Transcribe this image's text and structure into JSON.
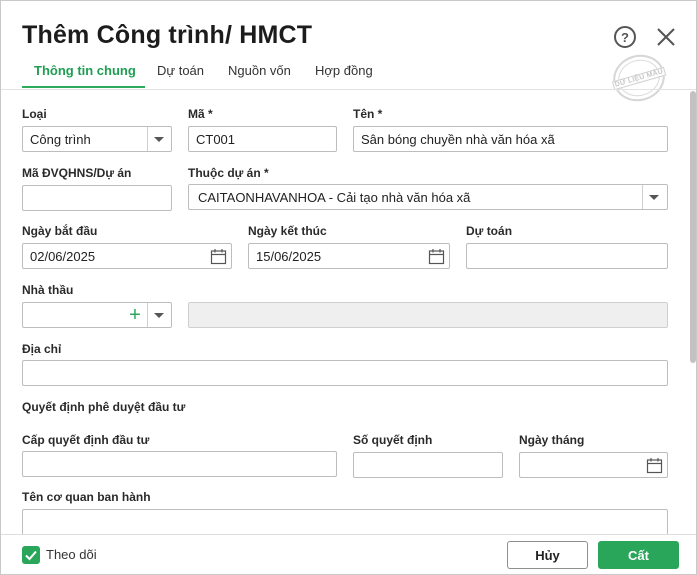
{
  "dialog": {
    "title": "Thêm Công trình/ HMCT",
    "help_icon": "?",
    "close_icon": "close-icon",
    "stamp_text": "DỮ LIỆU MẪU"
  },
  "tabs": [
    {
      "label": "Thông tin chung",
      "active": true
    },
    {
      "label": "Dự toán",
      "active": false
    },
    {
      "label": "Nguồn vốn",
      "active": false
    },
    {
      "label": "Hợp đồng",
      "active": false
    }
  ],
  "form": {
    "loai": {
      "label": "Loại",
      "value": "Công trình"
    },
    "ma": {
      "label": "Mã *",
      "value": "CT001"
    },
    "ten": {
      "label": "Tên *",
      "value": "Sân bóng chuyền nhà văn hóa xã"
    },
    "ma_dvqhns": {
      "label": "Mã ĐVQHNS/Dự án",
      "value": ""
    },
    "thuoc_du_an": {
      "label": "Thuộc dự án *",
      "value": "CAITAONHAVANHOA - Cải tạo nhà văn hóa xã"
    },
    "ngay_bat_dau": {
      "label": "Ngày bắt đầu",
      "value": "02/06/2025"
    },
    "ngay_ket_thuc": {
      "label": "Ngày kết thúc",
      "value": "15/06/2025"
    },
    "du_toan": {
      "label": "Dự toán",
      "value": ""
    },
    "nha_thau": {
      "label": "Nhà thầu",
      "value": "",
      "name_value": ""
    },
    "dia_chi": {
      "label": "Địa chỉ",
      "value": ""
    },
    "section_title": "Quyết định phê duyệt đầu tư",
    "cap_quyet_dinh": {
      "label": "Cấp quyết định đầu tư",
      "value": ""
    },
    "so_quyet_dinh": {
      "label": "Số quyết định",
      "value": ""
    },
    "ngay_thang": {
      "label": "Ngày tháng",
      "value": ""
    },
    "ten_co_quan": {
      "label": "Tên cơ quan ban hành",
      "value": ""
    }
  },
  "footer": {
    "follow_label": "Theo dõi",
    "follow_checked": true,
    "cancel_label": "Hủy",
    "save_label": "Cất"
  },
  "colors": {
    "accent": "#2aa65b",
    "active_tab": "#1e9e52"
  }
}
